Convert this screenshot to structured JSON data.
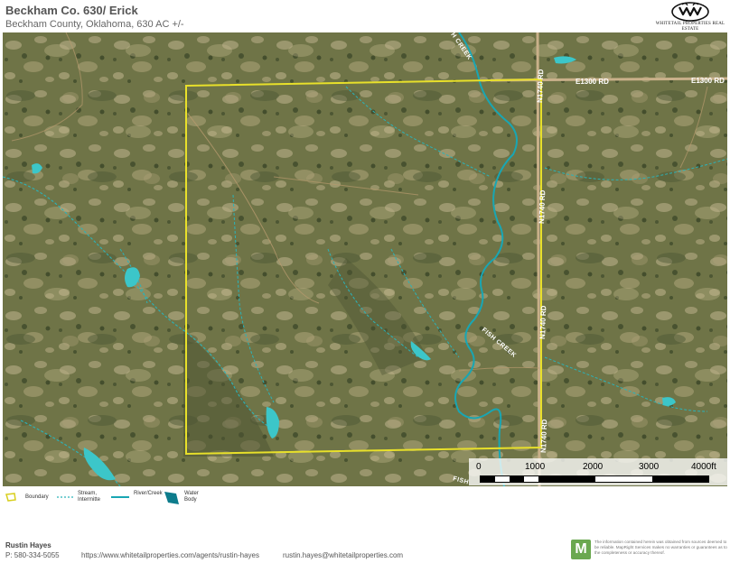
{
  "header": {
    "title": "Beckham Co. 630/ Erick",
    "subtitle": "Beckham County, Oklahoma, 630 AC +/-"
  },
  "logo": {
    "text_line1": "WHITETAIL PROPERTIES REAL ESTATE"
  },
  "map": {
    "roads": [
      {
        "label": "E1300 RD"
      },
      {
        "label": "E1300 RD"
      },
      {
        "label": "N1740 RD"
      },
      {
        "label": "N1740 RD"
      },
      {
        "label": "N1740 RD"
      },
      {
        "label": "N1740 RD"
      }
    ],
    "creek_labels": [
      "FISH CREEK",
      "H CREEK",
      "FISH"
    ],
    "colors": {
      "boundary": "#e8e02a",
      "river": "#19a6b3",
      "water_body": "#3cc6c9",
      "road": "#c9b08a",
      "terrain_base": "#6f7447"
    }
  },
  "scalebar": {
    "ticks": [
      "0",
      "1000",
      "2000",
      "3000",
      "4000ft"
    ]
  },
  "legend": {
    "items": [
      {
        "label": "Boundary",
        "icon": "boundary-polygon-icon"
      },
      {
        "label": "Stream, Intermitte",
        "icon": "stream-dashed-icon"
      },
      {
        "label": "River/Creek",
        "icon": "river-line-icon"
      },
      {
        "label": "Water Body",
        "icon": "water-body-polygon-icon"
      }
    ]
  },
  "footer": {
    "agent_name": "Rustin Hayes",
    "phone": "P: 580-334-5055",
    "url": "https://www.whitetailproperties.com/agents/rustin-hayes",
    "email": "rustin.hayes@whitetailproperties.com",
    "mlogo_letter": "M",
    "disclaimer": "The information contained herein was obtained from sources deemed to be reliable. MapRight Services makes no warranties or guarantees as to the completeness or accuracy thereof."
  }
}
